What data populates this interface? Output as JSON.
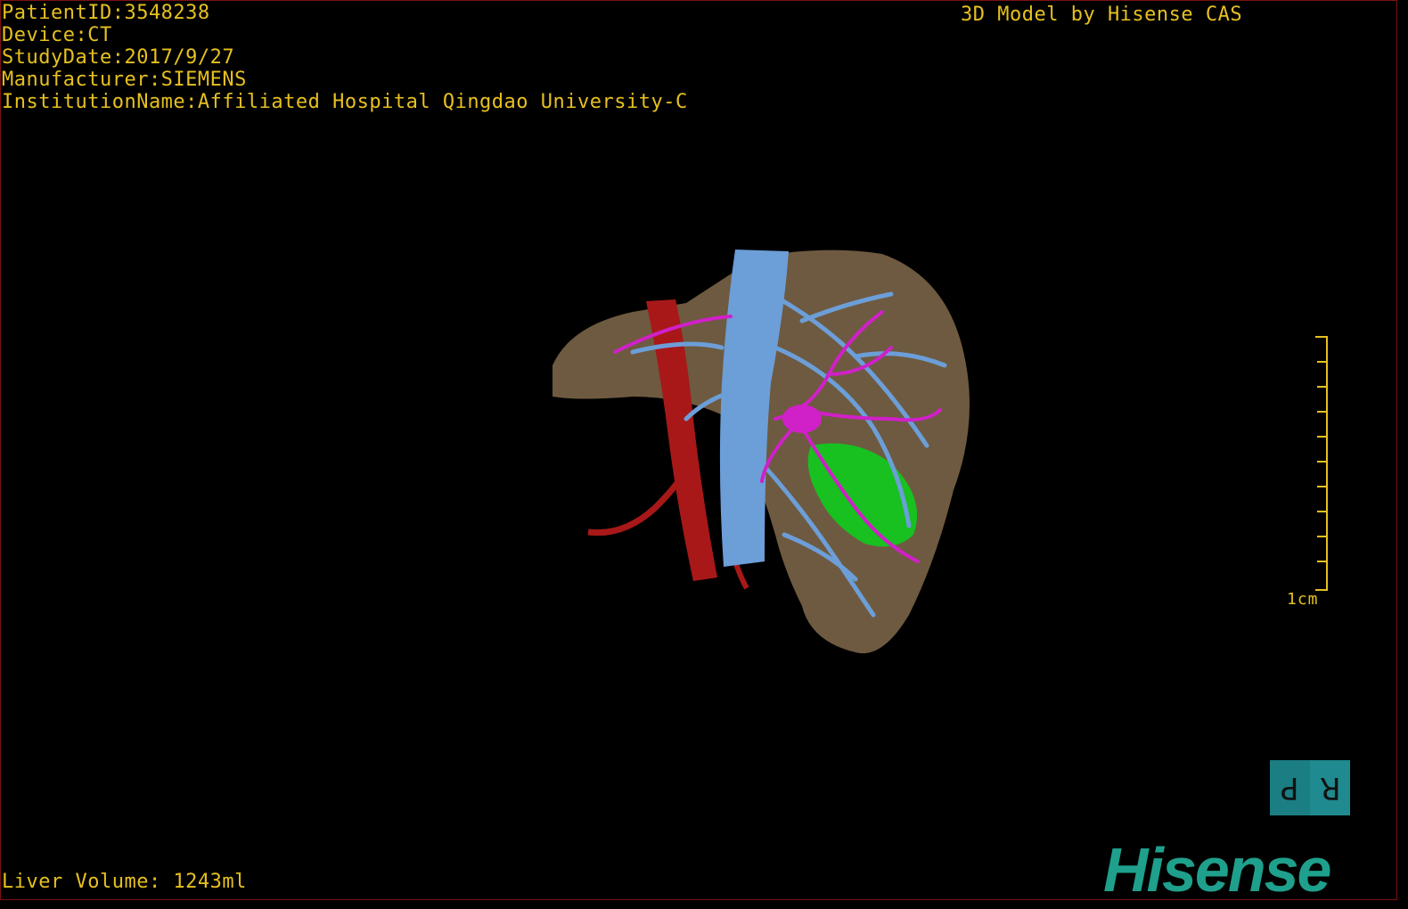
{
  "overlay": {
    "patient_id": "PatientID:3548238",
    "device": "Device:CT",
    "study_date": "StudyDate:2017/9/27",
    "manufacturer": "Manufacturer:SIEMENS",
    "institution": "InstitutionName:Affiliated Hospital Qingdao University-C"
  },
  "caption": "3D Model by Hisense CAS",
  "liver_volume": "Liver Volume: 1243ml",
  "scale": {
    "label": "1cm"
  },
  "orientation": {
    "left_letter": "P",
    "right_letter": "R"
  },
  "logo": "Hisense",
  "colors": {
    "overlay_text": "#e6c020",
    "liver": "#6e5a40",
    "hepatic_vein": "#6c9ed8",
    "portal_vein": "#d020c8",
    "artery": "#a81818",
    "gallbladder": "#18c020",
    "logo": "#1ea08c"
  }
}
